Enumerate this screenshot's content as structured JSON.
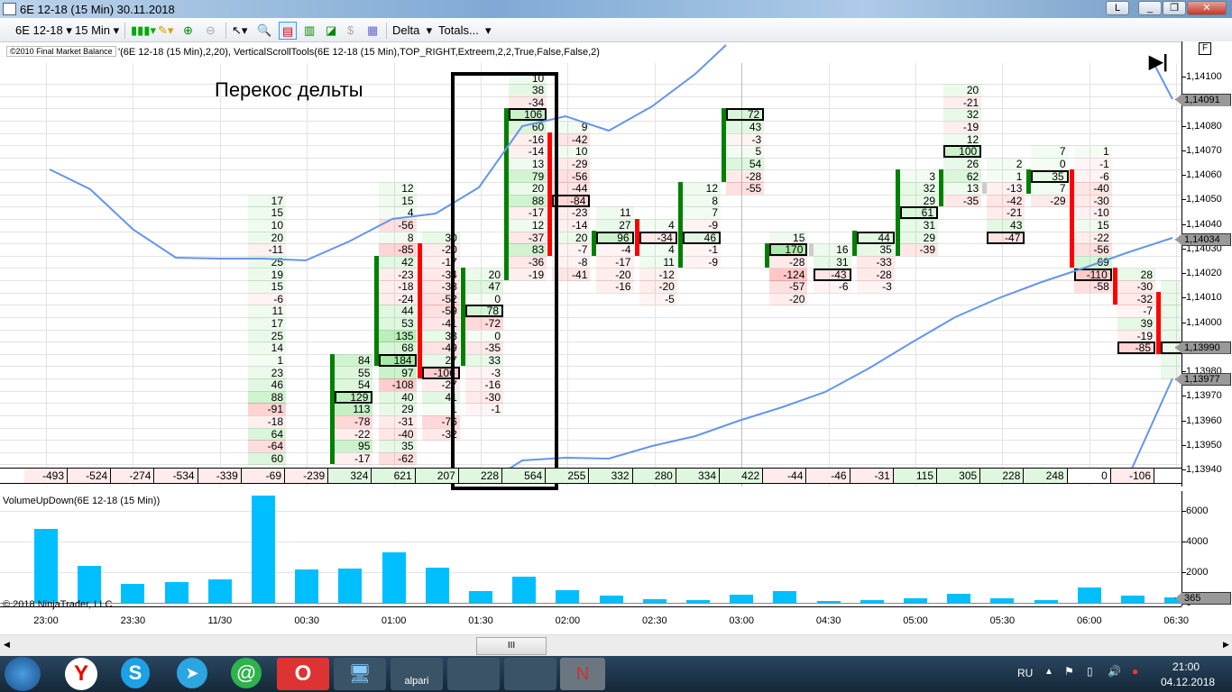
{
  "window": {
    "title": "6E 12-18 (15 Min)  30.11.2018",
    "buttons": [
      "L",
      "_",
      "❐",
      "✕"
    ]
  },
  "toolbar": {
    "instrument": "6E 12-18",
    "interval": "15 Min",
    "delta": "Delta",
    "totals": "Totals..."
  },
  "indicator_line": {
    "badge": "©2010 Final Market Balance",
    "text": "'(6E 12-18 (15 Min),2,20), VerticalScrollTools(6E 12-18 (15 Min),TOP_RIGHT,Extreem,2,2,True,False,False,2)"
  },
  "annotation": "Перекос дельты",
  "colors": {
    "up": "#008000",
    "down": "#ff0000",
    "indicator": "#6495ed",
    "volume": "#00bfff"
  },
  "price_axis": {
    "labels": [
      "1,14100",
      "1,14090",
      "1,14080",
      "1,14070",
      "1,14060",
      "1,14050",
      "1,14040",
      "1,14030",
      "1,14020",
      "1,14010",
      "1,14000",
      "1,13990",
      "1,13980",
      "1,13970",
      "1,13960",
      "1,13950",
      "1,13940"
    ],
    "markers": [
      {
        "label": "1,14091",
        "price": 1.14091
      },
      {
        "label": "1,14034",
        "price": 1.14034
      },
      {
        "label": "1,13990",
        "price": 1.1399
      },
      {
        "label": "1,13977",
        "price": 1.13977
      }
    ],
    "f_button": "F"
  },
  "footprint": [
    {
      "col": 5,
      "top": 1.1405,
      "values": [
        "17",
        "15",
        "10",
        "20",
        "-11",
        "25",
        "19",
        "15",
        "-6",
        "11",
        "17",
        "25",
        "14",
        "1",
        "23",
        "46",
        "88",
        "-91",
        "-18",
        "64",
        "-64",
        "60"
      ]
    },
    {
      "col": 7,
      "top": 1.13985,
      "values": [
        "84",
        "55",
        "54",
        "129",
        "113",
        "-78",
        "-22",
        "95",
        "-17"
      ],
      "poc": 3,
      "bar": {
        "dir": "up",
        "from": 1.13985,
        "to": 1.13945
      }
    },
    {
      "col": 8,
      "top": 1.14055,
      "values": [
        "12",
        "15",
        "4",
        "-56",
        "8",
        "-85",
        "42",
        "-23",
        "-18",
        "-24",
        "44",
        "53",
        "135",
        "68",
        "184",
        "97",
        "-108",
        "40",
        "29",
        "-31",
        "-40",
        "35",
        "-62"
      ],
      "poc": 14,
      "bar": {
        "dir": "up",
        "from": 1.14025,
        "to": 1.13985
      }
    },
    {
      "col": 9,
      "top": 1.14035,
      "values": [
        "30",
        "-20",
        "-17",
        "-34",
        "-38",
        "-52",
        "-59",
        "-41",
        "33",
        "-49",
        "27",
        "-106",
        "-27",
        "41",
        "1",
        "-76",
        "-32"
      ],
      "poc": 11,
      "bar": {
        "dir": "down",
        "from": 1.1403,
        "to": 1.1398
      }
    },
    {
      "col": 10,
      "top": 1.1402,
      "values": [
        "20",
        "47",
        "0",
        "78",
        "-72",
        "0",
        "-35",
        "33",
        "-3",
        "-16",
        "-30",
        "-1"
      ],
      "poc": 3,
      "bar": {
        "dir": "up",
        "from": 1.1402,
        "to": 1.13985
      }
    },
    {
      "col": 11,
      "top": 1.141,
      "values": [
        "10",
        "38",
        "-34",
        "106",
        "60",
        "-16",
        "-14",
        "13",
        "79",
        "20",
        "88",
        "-17",
        "12",
        "-37",
        "83",
        "-36",
        "-19"
      ],
      "poc": 3,
      "bar": {
        "dir": "up",
        "from": 1.14085,
        "to": 1.1402
      }
    },
    {
      "col": 12,
      "top": 1.1408,
      "values": [
        "9",
        "-42",
        "10",
        "-29",
        "-56",
        "-44",
        "-84",
        "-23",
        "-14",
        "20",
        "-7",
        "-8",
        "-41"
      ],
      "poc": 6,
      "bar": {
        "dir": "down",
        "from": 1.14075,
        "to": 1.1403
      }
    },
    {
      "col": 13,
      "top": 1.14045,
      "values": [
        "11",
        "27",
        "96",
        "-4",
        "-17",
        "-20",
        "-16"
      ],
      "poc": 2,
      "bar": {
        "dir": "up",
        "from": 1.14035,
        "to": 1.1403
      }
    },
    {
      "col": 14,
      "top": 1.1404,
      "values": [
        "4",
        "-34",
        "4",
        "11",
        "-12",
        "-20",
        "-5"
      ],
      "poc": 1,
      "bar": {
        "dir": "down",
        "from": 1.1404,
        "to": 1.1403
      }
    },
    {
      "col": 15,
      "top": 1.14055,
      "values": [
        "12",
        "8",
        "7",
        "-9",
        "46",
        "-1",
        "-9"
      ],
      "poc": 4,
      "bar": {
        "dir": "up",
        "from": 1.14055,
        "to": 1.14025
      }
    },
    {
      "col": 16,
      "top": 1.14085,
      "values": [
        "72",
        "43",
        "-3",
        "5",
        "54",
        "-28",
        "-55"
      ],
      "poc": 0,
      "bar": {
        "dir": "up",
        "from": 1.14085,
        "to": 1.1406
      }
    },
    {
      "col": 17,
      "top": 1.14035,
      "values": [
        "15",
        "170",
        "-28",
        "-124",
        "-57",
        "-20"
      ],
      "poc": 1,
      "bar": {
        "dir": "up",
        "from": 1.1403,
        "to": 1.14025
      }
    },
    {
      "col": 18,
      "top": 1.1403,
      "values": [
        "16",
        "31",
        "-43",
        "-6"
      ],
      "poc": 2,
      "bar": {
        "dir": "flat",
        "from": 1.1403,
        "to": 1.1403
      }
    },
    {
      "col": 19,
      "top": 1.14035,
      "values": [
        "44",
        "35",
        "-33",
        "-28",
        "-3"
      ],
      "poc": 0,
      "bar": {
        "dir": "up",
        "from": 1.14035,
        "to": 1.1403
      }
    },
    {
      "col": 20,
      "top": 1.1406,
      "values": [
        "3",
        "32",
        "29",
        "61",
        "31",
        "29",
        "-39"
      ],
      "poc": 3,
      "bar": {
        "dir": "up",
        "from": 1.1406,
        "to": 1.1403
      }
    },
    {
      "col": 21,
      "top": 1.14095,
      "values": [
        "20",
        "-21",
        "32",
        "-19",
        "12",
        "100",
        "26",
        "62",
        "13",
        "-35"
      ],
      "poc": 5,
      "bar": {
        "dir": "up",
        "from": 1.1406,
        "to": 1.1405
      }
    },
    {
      "col": 22,
      "top": 1.14065,
      "values": [
        "2",
        "1",
        "-13",
        "-42",
        "-21",
        "43",
        "-47"
      ],
      "poc": 6,
      "bar": {
        "dir": "flat",
        "from": 1.14055,
        "to": 1.14055
      }
    },
    {
      "col": 23,
      "top": 1.1407,
      "values": [
        "7",
        "0",
        "35",
        "7",
        "-29"
      ],
      "poc": 2,
      "bar": {
        "dir": "up",
        "from": 1.1406,
        "to": 1.14055
      }
    },
    {
      "col": 24,
      "top": 1.1407,
      "values": [
        "1",
        "-1",
        "-6",
        "-40",
        "-30",
        "-10",
        "15",
        "-22",
        "-56",
        "69",
        "-110",
        "-58"
      ],
      "poc": 10,
      "bar": {
        "dir": "down",
        "from": 1.1406,
        "to": 1.14025
      }
    },
    {
      "col": 25,
      "top": 1.1402,
      "values": [
        "28",
        "-30",
        "-32",
        "-7",
        "39",
        "-19",
        "-85"
      ],
      "poc": 6,
      "bar": {
        "dir": "down",
        "from": 1.1402,
        "to": 1.1401
      }
    },
    {
      "col": 26,
      "top": 1.14015,
      "values": [
        "",
        "",
        "",
        "",
        "",
        "",
        "",
        ""
      ],
      "poc": 5,
      "bar": {
        "dir": "down",
        "from": 1.1401,
        "to": 1.1399
      }
    }
  ],
  "totals": [
    "-493",
    "-524",
    "-274",
    "-534",
    "-339",
    "-69",
    "-239",
    "324",
    "621",
    "207",
    "228",
    "564",
    "255",
    "332",
    "280",
    "334",
    "422",
    "-44",
    "-46",
    "-31",
    "115",
    "305",
    "228",
    "248",
    "0",
    "-106",
    "-"
  ],
  "volume_panel": {
    "title": "VolumeUpDown(6E 12-18 (15 Min))",
    "copyright": "© 2018 NinjaTrader, LLC",
    "axis": [
      "6000",
      "4000",
      "2000",
      "0"
    ],
    "last": "365",
    "values": [
      4820,
      2410,
      1240,
      1350,
      1530,
      7000,
      2180,
      2240,
      3290,
      2290,
      760,
      1700,
      820,
      470,
      240,
      180,
      530,
      760,
      120,
      180,
      300,
      590,
      300,
      180,
      1000,
      470,
      365
    ]
  },
  "time_axis": [
    {
      "label": "23:00",
      "col": 0
    },
    {
      "label": "23:30",
      "col": 2
    },
    {
      "label": "11/30",
      "col": 4
    },
    {
      "label": "00:30",
      "col": 6
    },
    {
      "label": "01:00",
      "col": 8
    },
    {
      "label": "01:30",
      "col": 10
    },
    {
      "label": "02:00",
      "col": 12
    },
    {
      "label": "02:30",
      "col": 14
    },
    {
      "label": "03:00",
      "col": 16
    },
    {
      "label": "04:30",
      "col": 18
    },
    {
      "label": "05:00",
      "col": 20
    },
    {
      "label": "05:30",
      "col": 22
    },
    {
      "label": "06:00",
      "col": 24
    },
    {
      "label": "06:30",
      "col": 26
    }
  ],
  "scrollbar": {
    "thumb": "III"
  },
  "taskbar": {
    "lang": "RU",
    "time": "21:00",
    "date": "04.12.2018",
    "apps": [
      "start",
      "yandex",
      "skype",
      "telegram",
      "mail-agent",
      "opera",
      "remote-desktop",
      "alpari",
      "terminal-1",
      "terminal-2",
      "ninjatrader"
    ],
    "alpari_label": "alpari"
  }
}
